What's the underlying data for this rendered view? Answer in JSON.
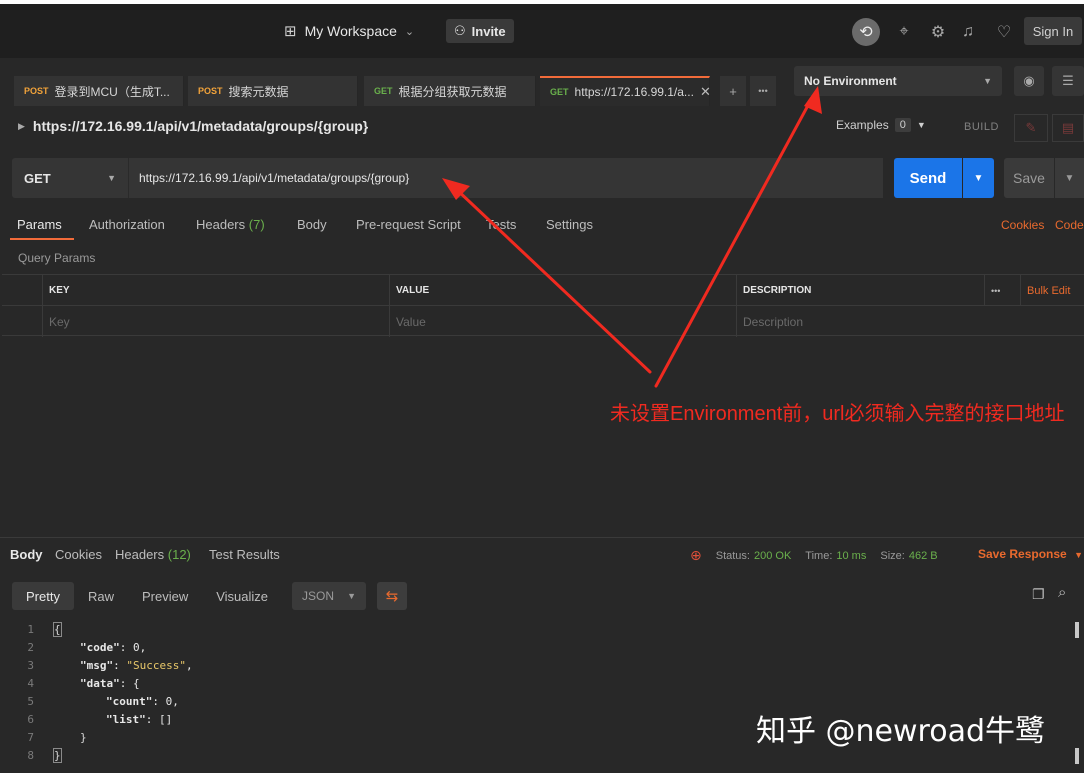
{
  "topbar": {
    "workspace_label": "My Workspace",
    "invite_label": "Invite",
    "signin_label": "Sign In"
  },
  "tabs": [
    {
      "method": "POST",
      "label": "登录到MCU（生成T..."
    },
    {
      "method": "POST",
      "label": "搜索元数据"
    },
    {
      "method": "GET",
      "label": "根据分组获取元数据"
    },
    {
      "method": "GET",
      "label": "https://172.16.99.1/a..."
    }
  ],
  "environment": {
    "selected": "No Environment"
  },
  "request": {
    "path": "https://172.16.99.1/api/v1/metadata/groups/{group}",
    "examples_label": "Examples",
    "examples_count": "0",
    "build_label": "BUILD",
    "method": "GET",
    "url": "https://172.16.99.1/api/v1/metadata/groups/{group}",
    "send_label": "Send",
    "save_label": "Save"
  },
  "request_tabs": {
    "params": "Params",
    "authorization": "Authorization",
    "headers": "Headers",
    "headers_count": "(7)",
    "body": "Body",
    "prerequest": "Pre-request Script",
    "tests": "Tests",
    "settings": "Settings",
    "cookies": "Cookies",
    "code": "Code"
  },
  "query_params": {
    "title": "Query Params",
    "columns": [
      "KEY",
      "VALUE",
      "DESCRIPTION"
    ],
    "bulk_edit": "Bulk Edit",
    "more": "•••",
    "placeholders": [
      "Key",
      "Value",
      "Description"
    ]
  },
  "annotation": {
    "text": "未设置Environment前，url必须输入完整的接口地址"
  },
  "response": {
    "tabs": {
      "body": "Body",
      "cookies": "Cookies",
      "headers": "Headers",
      "headers_count": "(12)",
      "test_results": "Test Results"
    },
    "status_label": "Status:",
    "status_value": "200 OK",
    "time_label": "Time:",
    "time_value": "10 ms",
    "size_label": "Size:",
    "size_value": "462 B",
    "save_response": "Save Response",
    "formats": [
      "Pretty",
      "Raw",
      "Preview",
      "Visualize"
    ],
    "format_type": "JSON",
    "code_lines": [
      {
        "n": "1",
        "text": "{"
      },
      {
        "n": "2",
        "key": "\"code\"",
        "rest": ": 0,"
      },
      {
        "n": "3",
        "key": "\"msg\"",
        "str": "\"Success\"",
        "rest": ","
      },
      {
        "n": "4",
        "key": "\"data\"",
        "rest": ": {"
      },
      {
        "n": "5",
        "key": "\"count\"",
        "rest": ": 0,"
      },
      {
        "n": "6",
        "key": "\"list\"",
        "rest": ": []"
      },
      {
        "n": "7",
        "text": "}"
      },
      {
        "n": "8",
        "text": "}"
      }
    ]
  },
  "watermark": "知乎 @newroad牛鹭"
}
